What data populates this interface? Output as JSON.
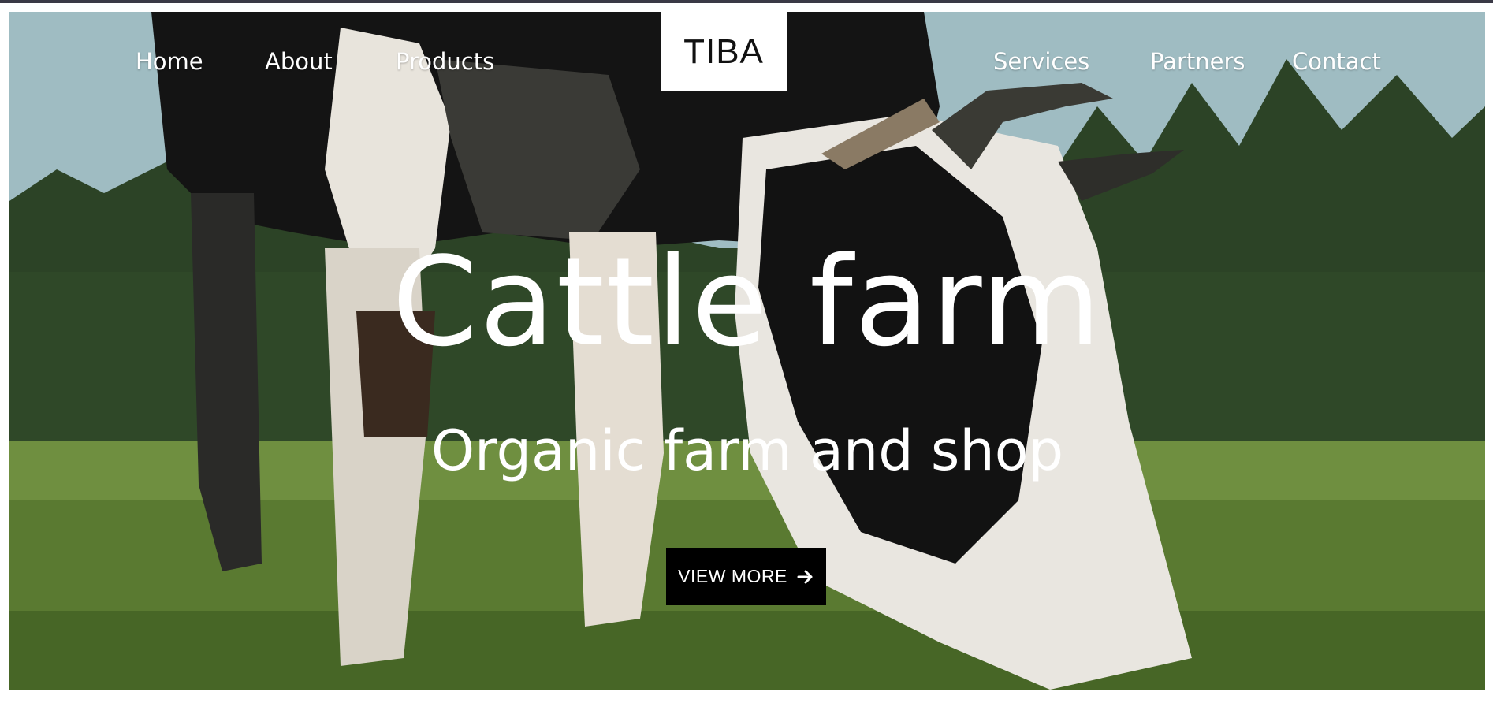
{
  "nav": {
    "left": [
      {
        "label": "Home"
      },
      {
        "label": "About"
      },
      {
        "label": "Products"
      }
    ],
    "right": [
      {
        "label": "Services"
      },
      {
        "label": "Partners"
      },
      {
        "label": "Contact"
      }
    ],
    "logo": "TIBA"
  },
  "hero": {
    "title": "Cattle farm",
    "subtitle": "Organic farm and shop",
    "cta_label": "VIEW MORE",
    "cta_icon": "arrow-right-icon",
    "image": "cow-grazing-photo"
  },
  "colors": {
    "topbar": "#3a3946",
    "cta_background": "#000000",
    "text": "#ffffff",
    "logo_box": "#ffffff"
  }
}
